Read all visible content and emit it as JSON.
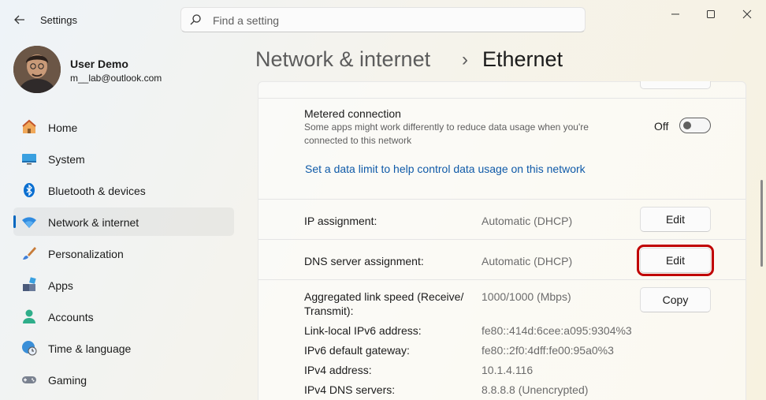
{
  "app": {
    "title": "Settings"
  },
  "search": {
    "placeholder": "Find a setting"
  },
  "user": {
    "name": "User Demo",
    "email": "m__lab@outlook.com"
  },
  "nav": {
    "items": [
      {
        "label": "Home",
        "icon": "home-icon"
      },
      {
        "label": "System",
        "icon": "system-icon"
      },
      {
        "label": "Bluetooth & devices",
        "icon": "bluetooth-icon"
      },
      {
        "label": "Network & internet",
        "icon": "wifi-icon",
        "active": true
      },
      {
        "label": "Personalization",
        "icon": "brush-icon"
      },
      {
        "label": "Apps",
        "icon": "apps-icon"
      },
      {
        "label": "Accounts",
        "icon": "accounts-icon"
      },
      {
        "label": "Time & language",
        "icon": "globe-clock-icon"
      },
      {
        "label": "Gaming",
        "icon": "gamepad-icon"
      }
    ]
  },
  "breadcrumb": {
    "parent": "Network & internet",
    "separator": "›",
    "current": "Ethernet"
  },
  "metered": {
    "title": "Metered connection",
    "description_line1": "Some apps might work differently to reduce data usage when you're",
    "description_line2": "connected to this network",
    "toggle_state": "Off",
    "link": "Set a data limit to help control data usage on this network"
  },
  "ip_assignment": {
    "label": "IP assignment:",
    "value": "Automatic (DHCP)",
    "button": "Edit"
  },
  "dns_assignment": {
    "label": "DNS server assignment:",
    "value": "Automatic (DHCP)",
    "button": "Edit"
  },
  "properties": {
    "link_speed_label_line1": "Aggregated link speed (Receive/",
    "link_speed_label_line2": "Transmit):",
    "link_speed_value": "1000/1000 (Mbps)",
    "copy_button": "Copy",
    "rows": [
      {
        "label": "Link-local IPv6 address:",
        "value": "fe80::414d:6cee:a095:9304%3"
      },
      {
        "label": "IPv6 default gateway:",
        "value": "fe80::2f0:4dff:fe00:95a0%3"
      },
      {
        "label": "IPv4 address:",
        "value": "10.1.4.116"
      },
      {
        "label": "IPv4 DNS servers:",
        "value": "8.8.8.8 (Unencrypted)"
      }
    ]
  },
  "colors": {
    "accent": "#0067c0",
    "highlight": "#c00000",
    "link": "#0f5aa8"
  }
}
